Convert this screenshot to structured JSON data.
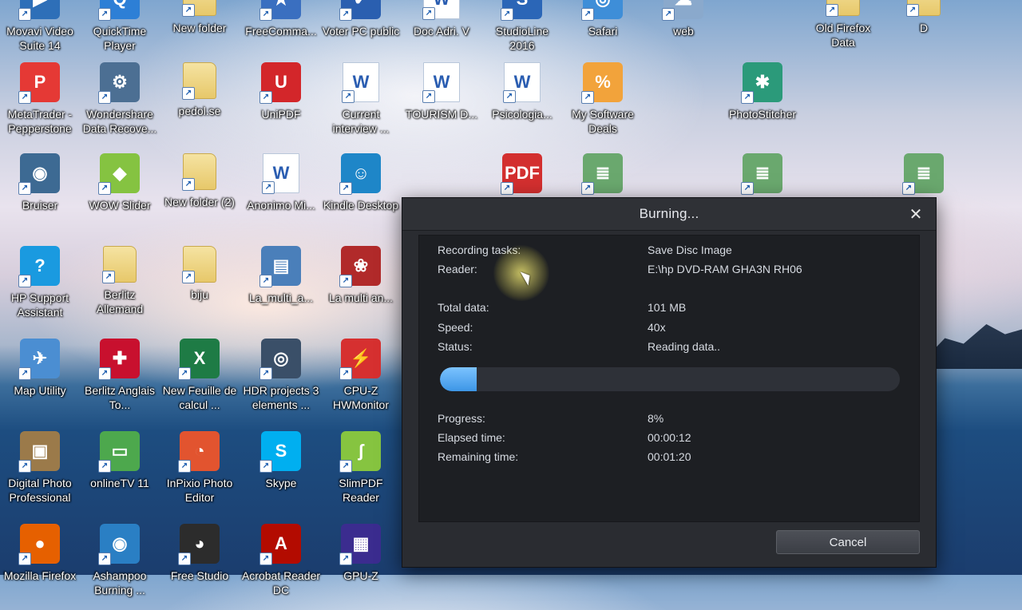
{
  "desktop": {
    "icons": [
      {
        "label": "Movavi Video Suite 14",
        "glyph": "▶",
        "color": "#2e6fb8"
      },
      {
        "label": "QuickTime Player",
        "glyph": "Q",
        "color": "#2d7fd6"
      },
      {
        "label": "New folder",
        "glyph": "",
        "color": "#e7c86a"
      },
      {
        "label": "FreeComma...",
        "glyph": "★",
        "color": "#3a6fc0"
      },
      {
        "label": "Voter PC public",
        "glyph": "✔",
        "color": "#2a5fb0"
      },
      {
        "label": "Doc Adri. V",
        "glyph": "W",
        "color": "#2a5db1"
      },
      {
        "label": "StudioLine 2016",
        "glyph": "S",
        "color": "#2b66b7"
      },
      {
        "label": "Safari",
        "glyph": "◎",
        "color": "#3e8ed8"
      },
      {
        "label": "web",
        "glyph": "☁",
        "color": "#8aa9cc"
      },
      {
        "label": "Old Firefox Data",
        "glyph": "",
        "color": "#e7c86a"
      },
      {
        "label": "D",
        "glyph": "",
        "color": "#e7c86a"
      },
      {
        "label": "MetaTrader - Pepperstone",
        "glyph": "P",
        "color": "#e53935"
      },
      {
        "label": "Wondershare Data Recove...",
        "glyph": "⚙",
        "color": "#4c6f93"
      },
      {
        "label": "pedol.se",
        "glyph": "",
        "color": "#e7c86a"
      },
      {
        "label": "UniPDF",
        "glyph": "U",
        "color": "#d3262a"
      },
      {
        "label": "Current interview ...",
        "glyph": "W",
        "color": "#2a5db1"
      },
      {
        "label": "TOURISM D...",
        "glyph": "W",
        "color": "#2a5db1"
      },
      {
        "label": "Psicologia...",
        "glyph": "W",
        "color": "#2a5db1"
      },
      {
        "label": "My Software Deals",
        "glyph": "%",
        "color": "#f2a33b"
      },
      {
        "label": "PhotoStitcher",
        "glyph": "✱",
        "color": "#2b9a7a"
      },
      {
        "label": "Bruiser",
        "glyph": "◉",
        "color": "#3d6a93"
      },
      {
        "label": "WOW Slider",
        "glyph": "◆",
        "color": "#85c341"
      },
      {
        "label": "New folder (2)",
        "glyph": "",
        "color": "#e7c86a"
      },
      {
        "label": "Anonimo Mi...",
        "glyph": "W",
        "color": "#2a5db1"
      },
      {
        "label": "Kindle Desktop",
        "glyph": "☺",
        "color": "#1e86c8"
      },
      {
        "label": "",
        "glyph": "PDF",
        "color": "#d32f2f"
      },
      {
        "label": "",
        "glyph": "≣",
        "color": "#6aa86e"
      },
      {
        "label": "",
        "glyph": "≣",
        "color": "#6aa86e"
      },
      {
        "label": "",
        "glyph": "≣",
        "color": "#6aa86e"
      },
      {
        "label": "HP Support Assistant",
        "glyph": "?",
        "color": "#1a9ae0"
      },
      {
        "label": "Berlitz Allemand",
        "glyph": "",
        "color": "#000"
      },
      {
        "label": "biju",
        "glyph": "",
        "color": "#e7c86a"
      },
      {
        "label": "La_multi_a...",
        "glyph": "▤",
        "color": "#4a7fba"
      },
      {
        "label": "La multi an...",
        "glyph": "❀",
        "color": "#b12a2a"
      },
      {
        "label": "Map Utility",
        "glyph": "✈",
        "color": "#4b8ed2"
      },
      {
        "label": "Berlitz Anglais To...",
        "glyph": "✚",
        "color": "#c8102e"
      },
      {
        "label": "New Feuille de calcul ...",
        "glyph": "X",
        "color": "#1e7b45"
      },
      {
        "label": "HDR projects 3 elements ...",
        "glyph": "◎",
        "color": "#3a4f68"
      },
      {
        "label": "CPU-Z HWMonitor",
        "glyph": "⚡",
        "color": "#d63030"
      },
      {
        "label": "Digital Photo Professional",
        "glyph": "▣",
        "color": "#9b7a4a"
      },
      {
        "label": "onlineTV 11",
        "glyph": "▭",
        "color": "#4da84d"
      },
      {
        "label": "InPixio Photo Editor",
        "glyph": "◔",
        "color": "#e2542f"
      },
      {
        "label": "Skype",
        "glyph": "S",
        "color": "#00aff0"
      },
      {
        "label": "SlimPDF Reader",
        "glyph": "ʃ",
        "color": "#86c440"
      },
      {
        "label": "Mozilla Firefox",
        "glyph": "●",
        "color": "#e66000"
      },
      {
        "label": "Ashampoo Burning ...",
        "glyph": "◉",
        "color": "#2a7fc4"
      },
      {
        "label": "Free Studio",
        "glyph": "◕",
        "color": "#2c2c2c"
      },
      {
        "label": "Acrobat Reader DC",
        "glyph": "A",
        "color": "#b30b00"
      },
      {
        "label": "GPU-Z",
        "glyph": "▦",
        "color": "#3b2c8f"
      }
    ]
  },
  "dialog": {
    "title": "Burning...",
    "close_glyph": "✕",
    "rows": [
      {
        "k": "Recording tasks:",
        "v": "Save Disc Image"
      },
      {
        "k": "Reader:",
        "v": "E:\\hp DVD-RAM GHA3N RH06"
      },
      {
        "k": "Total data:",
        "v": "101 MB"
      },
      {
        "k": "Speed:",
        "v": "40x"
      },
      {
        "k": "Status:",
        "v": "Reading data.."
      },
      {
        "k": "Progress:",
        "v": "8%"
      },
      {
        "k": "Elapsed time:",
        "v": "00:00:12"
      },
      {
        "k": "Remaining time:",
        "v": "00:01:20"
      }
    ],
    "progress_fraction": 0.08,
    "cancel_label": "Cancel",
    "accent": "#3d96e6"
  }
}
